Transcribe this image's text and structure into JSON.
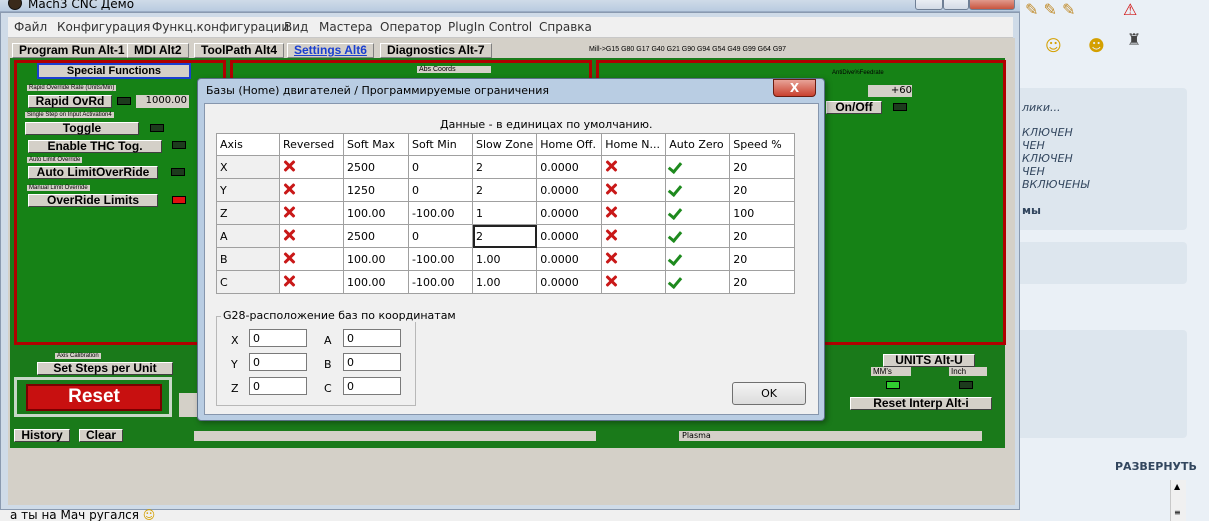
{
  "window": {
    "title": "Mach3 CNC  Демо"
  },
  "menu": [
    "Файл",
    "Конфигурация",
    "Функц.конфигурации",
    "Вид",
    "Мастера",
    "Оператор",
    "PlugIn Control",
    "Справка"
  ],
  "tabs": [
    "Program Run Alt-1",
    "MDI Alt2",
    "ToolPath Alt4",
    "Settings Alt6",
    "Diagnostics Alt-7"
  ],
  "gcodes": "Mill->G15  G80 G17 G40 G21 G90 G94 G54 G49 G99 G64 G97",
  "special_functions": {
    "title": "Special Functions",
    "rapid_label": "Rapid Override Rate (Units/Min)",
    "rapid_button": "Rapid OvRd",
    "rapid_value": "1000.00",
    "single_step_label": "Single Step on Input Activation4",
    "toggle_button": "Toggle",
    "thc_button": "Enable THC Tog.",
    "auto_limit_label": "Auto Limit Override",
    "auto_limit_button": "Auto LimitOverRide",
    "manual_limit_label": "Manual Limit Override",
    "override_button": "OverRide Limits"
  },
  "abs_coords_label": "Abs Coords",
  "antidive_label": "AntiDive%Feedrate",
  "antidive_value": "+60",
  "onoff_button": "On/Off",
  "axis_calibration_label": "Axis Calibration",
  "set_steps_button": "Set Steps per Unit",
  "reset_button": "Reset",
  "history_button": "History",
  "clear_button": "Clear",
  "plasma_label": "Plasma",
  "units": {
    "button": "UNITS Alt-U",
    "mm": "MM's",
    "inch": "Inch"
  },
  "reset_interp_button": "Reset Interp Alt-i",
  "dialog": {
    "title": "Базы (Home) двигателей / Программируемые ограничения",
    "close": "X",
    "caption": "Данные - в единицах по умолчанию.",
    "columns": [
      "Axis",
      "Reversed",
      "Soft Max",
      "Soft Min",
      "Slow Zone",
      "Home Off.",
      "Home N...",
      "Auto Zero",
      "Speed %"
    ],
    "rows": [
      {
        "axis": "X",
        "soft_max": "2500",
        "soft_min": "0",
        "slow_zone": "2",
        "home_off": "0.0000",
        "speed": "20"
      },
      {
        "axis": "Y",
        "soft_max": "1250",
        "soft_min": "0",
        "slow_zone": "2",
        "home_off": "0.0000",
        "speed": "20"
      },
      {
        "axis": "Z",
        "soft_max": "100.00",
        "soft_min": "-100.00",
        "slow_zone": "1",
        "home_off": "0.0000",
        "speed": "100"
      },
      {
        "axis": "A",
        "soft_max": "2500",
        "soft_min": "0",
        "slow_zone": "2",
        "home_off": "0.0000",
        "speed": "20"
      },
      {
        "axis": "B",
        "soft_max": "100.00",
        "soft_min": "-100.00",
        "slow_zone": "1.00",
        "home_off": "0.0000",
        "speed": "20"
      },
      {
        "axis": "C",
        "soft_max": "100.00",
        "soft_min": "-100.00",
        "slow_zone": "1.00",
        "home_off": "0.0000",
        "speed": "20"
      }
    ],
    "g28": {
      "legend": "G28-расположение баз по координатам",
      "x_label": "X",
      "x": "0",
      "y_label": "Y",
      "y": "0",
      "z_label": "Z",
      "z": "0",
      "a_label": "A",
      "a": "0",
      "b_label": "B",
      "b": "0",
      "c_label": "C",
      "c": "0"
    },
    "ok": "OK"
  },
  "right_panel": {
    "lines": [
      "лики...",
      "КЛЮЧЕН",
      "ЧЕН",
      "КЛЮЧЕН",
      "ЧЕН",
      "ВКЛЮЧЕНЫ",
      "мы"
    ],
    "expand": "РАЗВЕРНУТЬ"
  },
  "chat_line": "а ты на Мач ругался"
}
